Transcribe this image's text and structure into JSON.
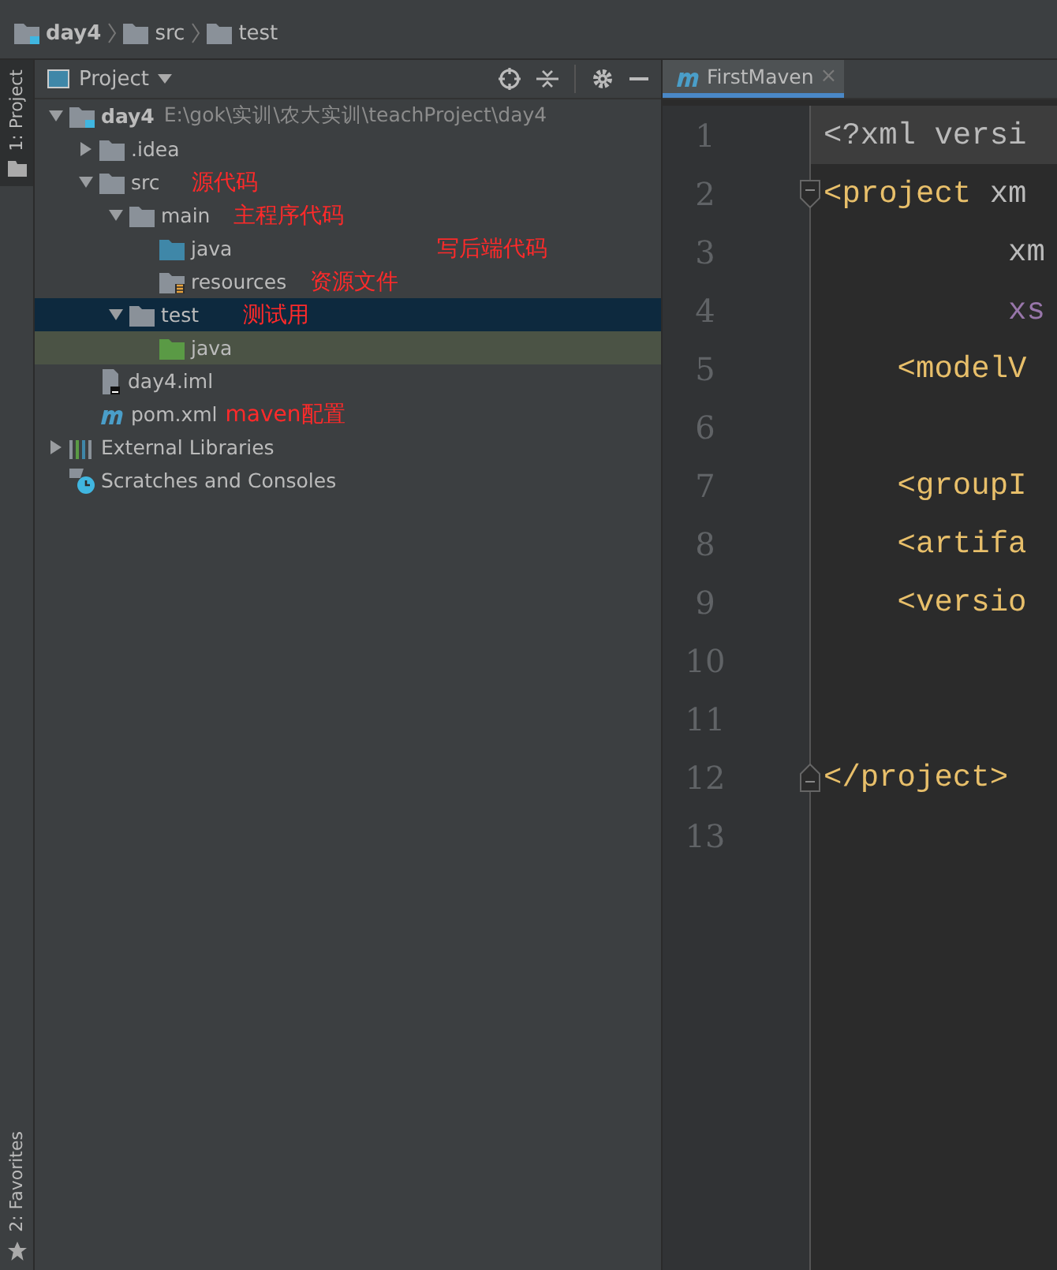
{
  "breadcrumb": [
    {
      "label": "day4",
      "kind": "module"
    },
    {
      "label": "src",
      "kind": "folder"
    },
    {
      "label": "test",
      "kind": "folder"
    }
  ],
  "tool_strip": {
    "top": {
      "label": "1: Project",
      "selected": true
    },
    "bottom": {
      "label": "2: Favorites",
      "selected": false
    }
  },
  "project_panel": {
    "title": "Project",
    "tree": [
      {
        "label": "day4",
        "path": "E:\\gok\\实训\\农大实训\\teachProject\\day4",
        "kind": "module",
        "expanded": true,
        "selected": false,
        "hovered": false,
        "children": [
          {
            "label": ".idea",
            "kind": "folder",
            "expanded": false,
            "selected": false,
            "hovered": false
          },
          {
            "label": "src",
            "kind": "folder",
            "expanded": true,
            "selected": false,
            "hovered": false,
            "note": "源代码",
            "children": [
              {
                "label": "main",
                "kind": "folder",
                "expanded": true,
                "selected": false,
                "hovered": false,
                "note": "主程序代码",
                "children": [
                  {
                    "label": "java",
                    "kind": "source",
                    "selected": false,
                    "hovered": false,
                    "note": "写后端代码"
                  },
                  {
                    "label": "resources",
                    "kind": "resources",
                    "selected": false,
                    "hovered": false,
                    "note": "资源文件"
                  }
                ]
              },
              {
                "label": "test",
                "kind": "folder",
                "expanded": true,
                "selected": true,
                "hovered": false,
                "note": "测试用",
                "children": [
                  {
                    "label": "java",
                    "kind": "test",
                    "selected": false,
                    "hovered": true
                  }
                ]
              }
            ]
          },
          {
            "label": "day4.iml",
            "kind": "iml",
            "selected": false,
            "hovered": false
          },
          {
            "label": "pom.xml",
            "kind": "maven",
            "selected": false,
            "hovered": false,
            "note": "maven配置"
          }
        ]
      },
      {
        "label": "External Libraries",
        "kind": "libraries",
        "expanded": false,
        "selected": false,
        "hovered": false
      },
      {
        "label": "Scratches and Consoles",
        "kind": "scratches",
        "selected": false,
        "hovered": false
      }
    ]
  },
  "editor": {
    "tabs": [
      {
        "label": "FirstMaven",
        "close": "×",
        "selected": true
      }
    ],
    "lines": [
      {
        "number": "1",
        "current": true,
        "kind": "plain",
        "tokens": [
          {
            "text": "<?xml versi",
            "kind": "plain"
          }
        ]
      },
      {
        "number": "2",
        "current": false,
        "kind": "fold_start",
        "tokens": [
          {
            "text": "<project",
            "kind": "tag"
          },
          {
            "text": " xm",
            "kind": "plain"
          }
        ]
      },
      {
        "number": "3",
        "current": false,
        "kind": "plain",
        "tokens": [
          {
            "text": "          xm",
            "kind": "plain"
          }
        ]
      },
      {
        "number": "4",
        "current": false,
        "kind": "plain",
        "tokens": [
          {
            "text": "          xs",
            "kind": "ns"
          }
        ]
      },
      {
        "number": "5",
        "current": false,
        "kind": "plain",
        "tokens": [
          {
            "text": "    <modelV",
            "kind": "tag"
          }
        ]
      },
      {
        "number": "6",
        "current": false,
        "kind": "plain"
      },
      {
        "number": "7",
        "current": false,
        "kind": "plain",
        "tokens": [
          {
            "text": "    <groupI",
            "kind": "tag"
          }
        ]
      },
      {
        "number": "8",
        "current": false,
        "kind": "plain",
        "tokens": [
          {
            "text": "    <artifa",
            "kind": "tag"
          }
        ]
      },
      {
        "number": "9",
        "current": false,
        "kind": "plain",
        "tokens": [
          {
            "text": "    <versio",
            "kind": "tag"
          }
        ]
      },
      {
        "number": "10",
        "current": false,
        "kind": "plain"
      },
      {
        "number": "11",
        "current": false,
        "kind": "plain"
      },
      {
        "number": "12",
        "current": false,
        "kind": "fold_end",
        "tokens": [
          {
            "text": "</project>",
            "kind": "tag"
          }
        ]
      },
      {
        "number": "13",
        "current": false,
        "kind": "plain"
      }
    ]
  }
}
